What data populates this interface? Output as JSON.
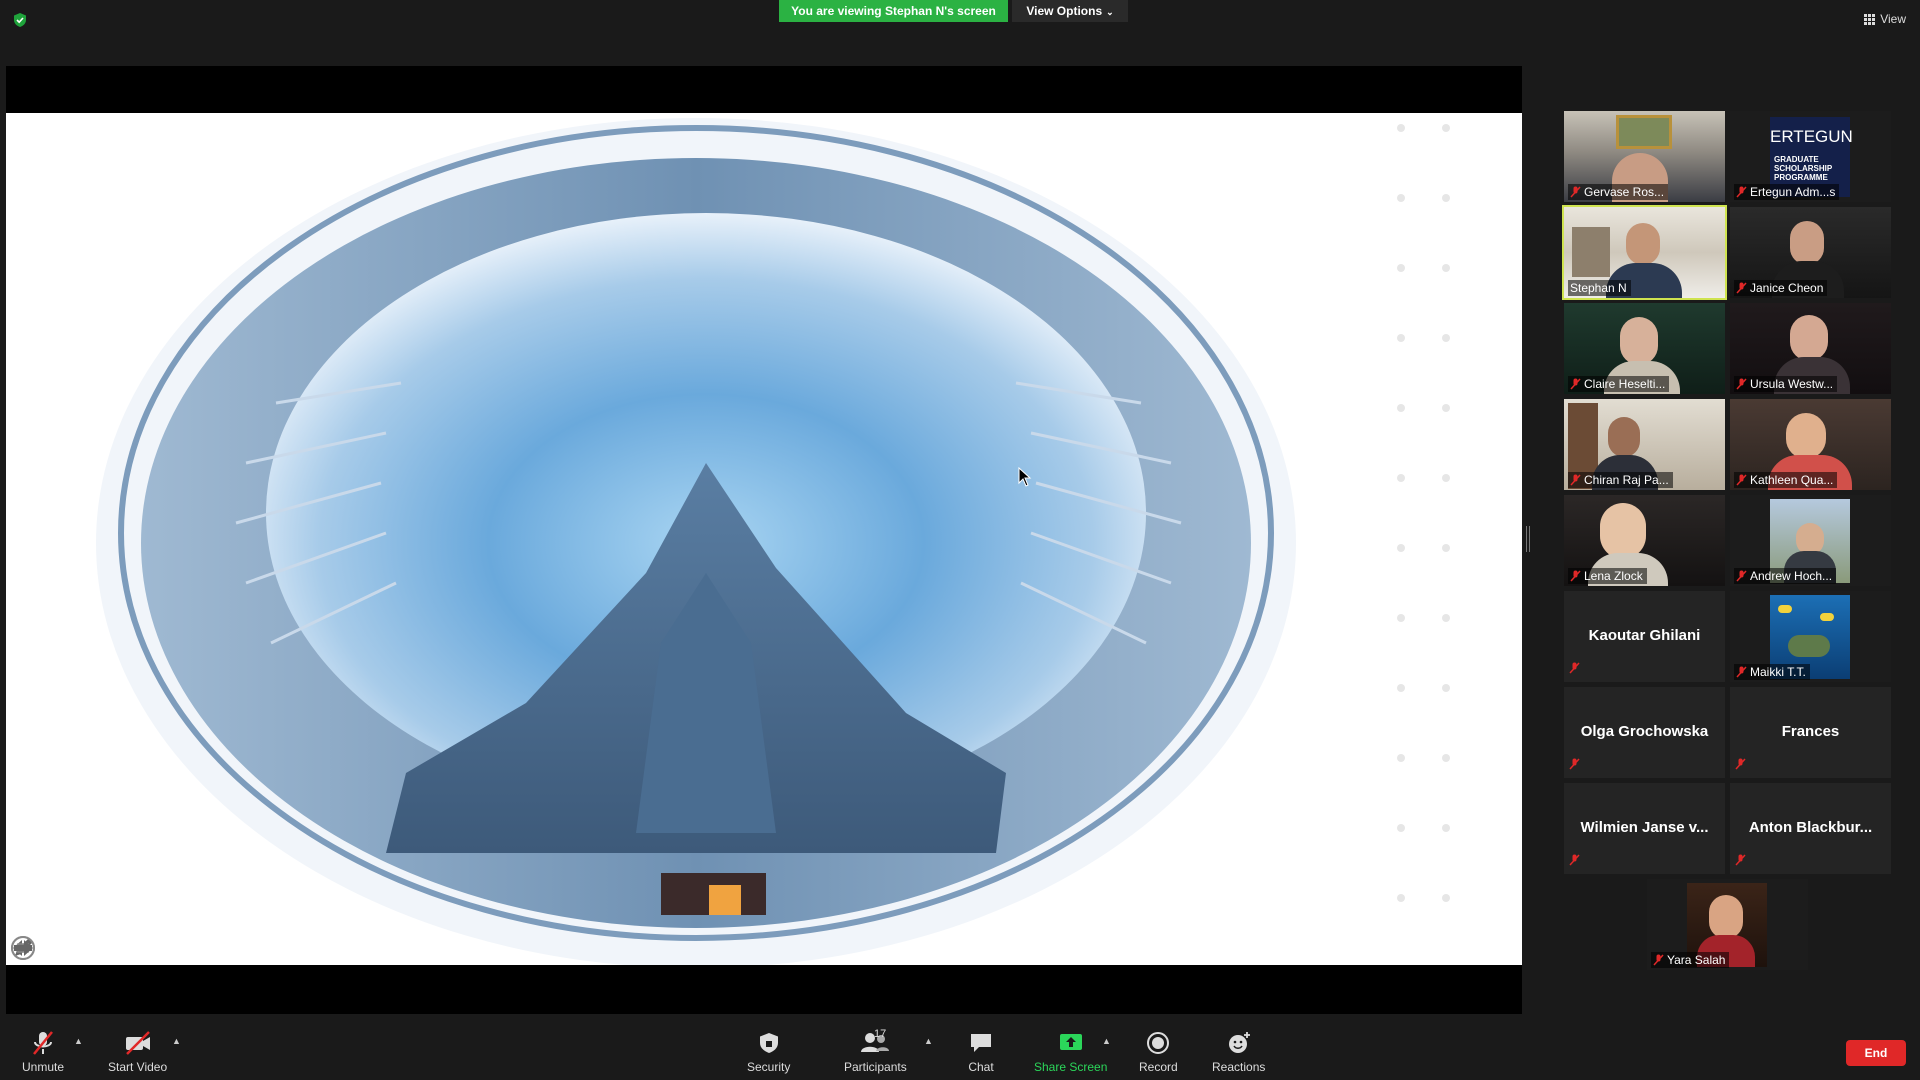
{
  "banner": {
    "viewing_text": "You are viewing Stephan N's screen",
    "view_options_label": "View Options"
  },
  "top_right": {
    "view_label": "View"
  },
  "colors": {
    "banner_green": "#2bb243",
    "active_speaker": "#cfe34f",
    "end_red": "#e02828",
    "share_green": "#2bd65a"
  },
  "participants": [
    {
      "name": "Gervase Ros...",
      "muted": true,
      "video": true
    },
    {
      "name": "Ertegun Adm...s",
      "muted": true,
      "video": true,
      "logo_text": "ERTEGUN",
      "logo_sub": "GRADUATE SCHOLARSHIP PROGRAMME"
    },
    {
      "name": "Stephan N",
      "muted": false,
      "video": true,
      "active": true
    },
    {
      "name": "Janice Cheon",
      "muted": true,
      "video": true
    },
    {
      "name": "Claire Heselti...",
      "muted": true,
      "video": true
    },
    {
      "name": "Ursula Westw...",
      "muted": true,
      "video": true
    },
    {
      "name": "Chiran Raj Pa...",
      "muted": true,
      "video": true
    },
    {
      "name": "Kathleen Qua...",
      "muted": true,
      "video": true
    },
    {
      "name": "Lena Zlock",
      "muted": true,
      "video": true
    },
    {
      "name": "Andrew Hoch...",
      "muted": true,
      "video": true
    },
    {
      "name": "Kaoutar Ghilani",
      "muted": true,
      "video": false
    },
    {
      "name": "Maikki T.T.",
      "muted": true,
      "video": true
    },
    {
      "name": "Olga Grochowska",
      "muted": true,
      "video": false
    },
    {
      "name": "Frances",
      "muted": true,
      "video": false
    },
    {
      "name": "Wilmien Janse v...",
      "muted": true,
      "video": false
    },
    {
      "name": "Anton  Blackbur...",
      "muted": true,
      "video": false
    },
    {
      "name": "Yara Salah",
      "muted": true,
      "video": true
    }
  ],
  "toolbar": {
    "unmute": "Unmute",
    "start_video": "Start Video",
    "security": "Security",
    "participants": "Participants",
    "participants_count": "17",
    "chat": "Chat",
    "share_screen": "Share Screen",
    "record": "Record",
    "reactions": "Reactions",
    "end": "End"
  }
}
